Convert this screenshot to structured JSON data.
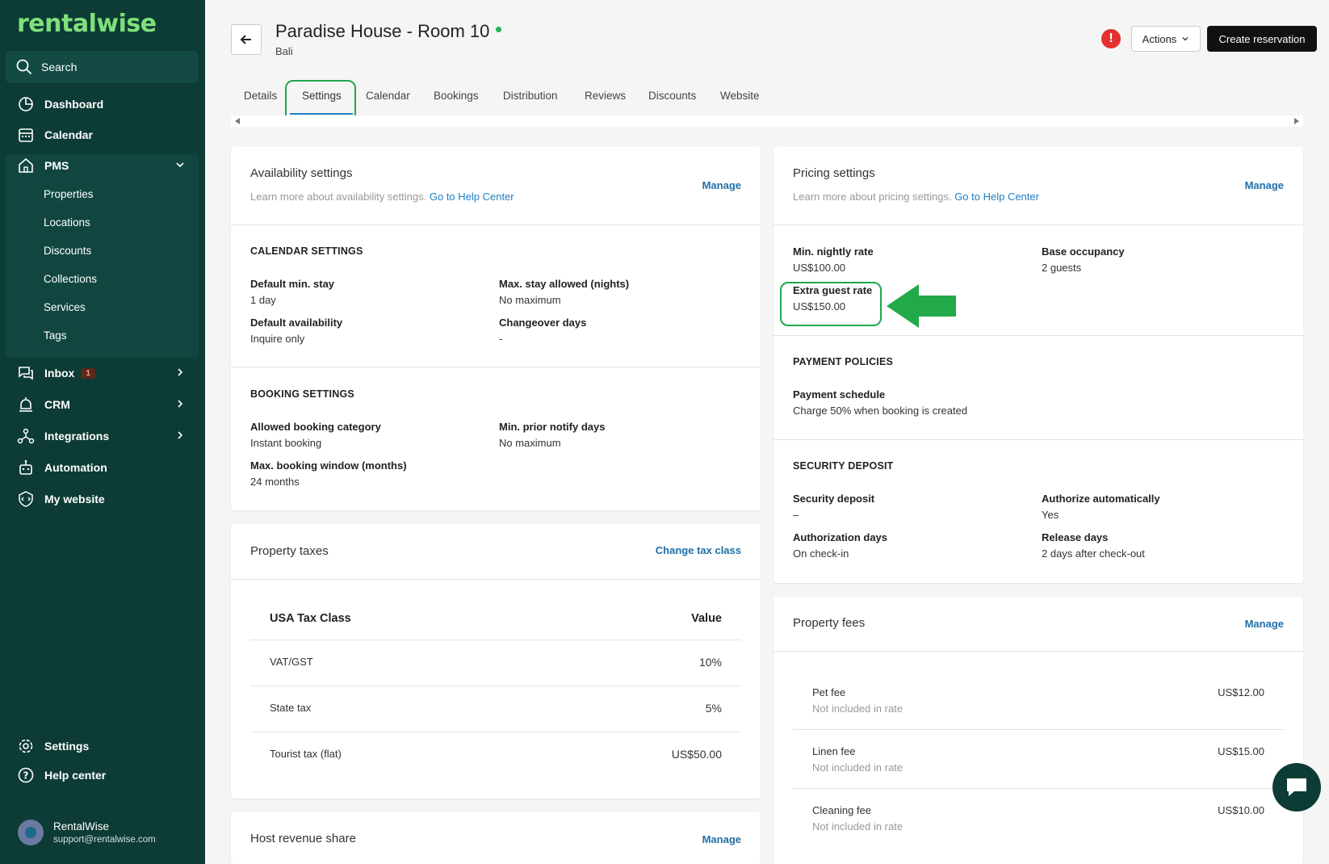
{
  "brand": {
    "logo": "rentalwise",
    "accent": "#7ee07a",
    "sidebar_bg": "#0d3b35"
  },
  "sidebar": {
    "search": "Search",
    "dashboard": "Dashboard",
    "calendar": "Calendar",
    "pms": "PMS",
    "pms_items": [
      "Properties",
      "Locations",
      "Discounts",
      "Collections",
      "Services",
      "Tags"
    ],
    "inbox": "Inbox",
    "inbox_badge": "1",
    "crm": "CRM",
    "integrations": "Integrations",
    "automation": "Automation",
    "my_website": "My website",
    "settings": "Settings",
    "help_center": "Help center",
    "user_name": "RentalWise",
    "user_email": "support@rentalwise.com"
  },
  "header": {
    "title": "Paradise House - Room 10",
    "subtitle": "Bali",
    "actions_label": "Actions",
    "create_label": "Create reservation"
  },
  "tabs": [
    "Details",
    "Settings",
    "Calendar",
    "Bookings",
    "Distribution",
    "Reviews",
    "Discounts",
    "Website"
  ],
  "availability": {
    "title": "Availability settings",
    "desc": "Learn more about availability settings.",
    "help_link": "Go to Help Center",
    "manage": "Manage",
    "calendar_head": "CALENDAR SETTINGS",
    "min_stay_label": "Default min. stay",
    "min_stay_value": "1 day",
    "max_stay_label": "Max. stay allowed (nights)",
    "max_stay_value": "No maximum",
    "availability_label": "Default availability",
    "availability_value": "Inquire only",
    "changeover_label": "Changeover days",
    "changeover_value": "-",
    "booking_head": "BOOKING SETTINGS",
    "category_label": "Allowed booking category",
    "category_value": "Instant booking",
    "notify_label": "Min. prior notify days",
    "notify_value": "No maximum",
    "window_label": "Max. booking window (months)",
    "window_value": "24 months"
  },
  "taxes": {
    "title": "Property taxes",
    "change_link": "Change tax class",
    "col_class": "USA Tax Class",
    "col_value": "Value",
    "rows": [
      {
        "name": "VAT/GST",
        "value": "10%"
      },
      {
        "name": "State tax",
        "value": "5%"
      },
      {
        "name": "Tourist tax (flat)",
        "value": "US$50.00"
      }
    ]
  },
  "revenue": {
    "title": "Host revenue share",
    "manage": "Manage"
  },
  "pricing": {
    "title": "Pricing settings",
    "desc": "Learn more about pricing settings.",
    "help_link": "Go to Help Center",
    "manage": "Manage",
    "min_rate_label": "Min. nightly rate",
    "min_rate_value": "US$100.00",
    "base_occ_label": "Base occupancy",
    "base_occ_value": "2 guests",
    "extra_label": "Extra guest rate",
    "extra_value": "US$150.00",
    "payment_head": "PAYMENT POLICIES",
    "schedule_label": "Payment schedule",
    "schedule_value": "Charge 50% when booking is created",
    "security_head": "SECURITY DEPOSIT",
    "deposit_label": "Security deposit",
    "deposit_value": "–",
    "authorize_label": "Authorize automatically",
    "authorize_value": "Yes",
    "auth_days_label": "Authorization days",
    "auth_days_value": "On check-in",
    "release_label": "Release days",
    "release_value": "2 days after check-out"
  },
  "fees": {
    "title": "Property fees",
    "manage": "Manage",
    "rows": [
      {
        "name": "Pet fee",
        "note": "Not included in rate",
        "value": "US$12.00"
      },
      {
        "name": "Linen fee",
        "note": "Not included in rate",
        "value": "US$15.00"
      },
      {
        "name": "Cleaning fee",
        "note": "Not included in rate",
        "value": "US$10.00"
      }
    ]
  }
}
